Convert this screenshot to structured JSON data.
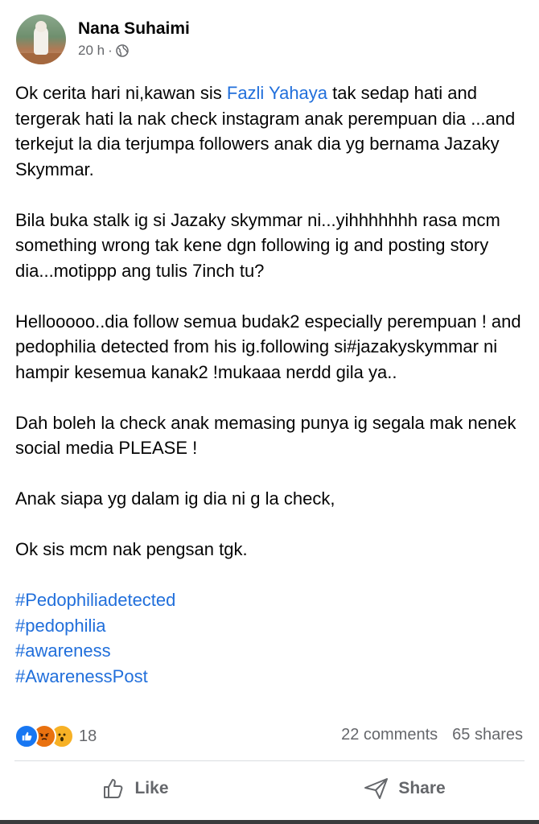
{
  "post": {
    "author": "Nana Suhaimi",
    "time": "20 h",
    "separator": "·",
    "privacy_icon": "globe-icon",
    "para1_before": "Ok cerita hari ni,kawan sis ",
    "mention": "Fazli Yahaya",
    "para1_after": " tak sedap hati and tergerak hati la nak check instagram anak perempuan dia ...and terkejut la dia terjumpa followers anak dia yg bernama Jazaky Skymmar.",
    "para2": "Bila buka stalk ig si Jazaky skymmar ni...yihhhhhhh rasa mcm something wrong tak kene dgn following ig and posting story dia...motippp ang tulis 7inch tu?",
    "para3": "Hellooooo..dia follow semua budak2 especially perempuan !  and pedophilia detected from his ig.following si#jazakyskymmar ni hampir kesemua kanak2 !mukaaa nerdd gila ya..",
    "para4": "Dah boleh la check anak memasing punya ig segala mak nenek social media PLEASE !",
    "para5": "Anak siapa yg dalam ig dia ni g la check,",
    "para6": "Ok sis mcm nak pengsan tgk.",
    "hashtags": [
      "#Pedophiliadetected",
      "#pedophilia",
      "#awareness",
      "#AwarenessPost"
    ]
  },
  "engagement": {
    "reaction_count": "18",
    "comments": "22 comments",
    "shares": "65 shares",
    "reaction_icons": [
      "like-icon",
      "angry-icon",
      "wow-icon"
    ]
  },
  "actions": {
    "like_label": "Like",
    "share_label": "Share"
  },
  "colors": {
    "link": "#216fdb",
    "muted": "#65676b",
    "like_blue": "#1877f2"
  }
}
